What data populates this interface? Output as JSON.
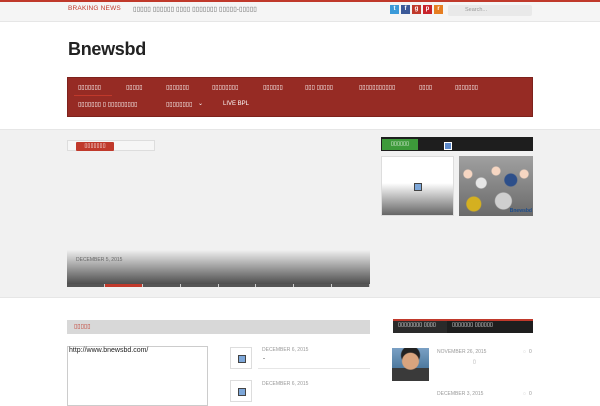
{
  "topbar": {
    "breaking_label": "BRAKING NEWS",
    "breaking_text": "▯▯▯▯▯ ▯▯▯▯▯▯ ▯▯▯▯ ▯▯▯▯▯▯▯ ▯▯▯▯▯-▯▯▯▯▯",
    "search_placeholder": "Search...",
    "social": [
      {
        "icon": "twitter-icon",
        "glyph": "t",
        "color": "#3b9ad9"
      },
      {
        "icon": "facebook-icon",
        "glyph": "f",
        "color": "#3b5998"
      },
      {
        "icon": "google-plus-icon",
        "glyph": "g",
        "color": "#c0392b"
      },
      {
        "icon": "pinterest-icon",
        "glyph": "p",
        "color": "#c8232c"
      },
      {
        "icon": "rss-icon",
        "glyph": "r",
        "color": "#e67e22"
      }
    ]
  },
  "site": {
    "logo": "Bnewsbd"
  },
  "nav": {
    "row1": [
      "▯▯▯▯▯▯▯",
      "▯▯▯▯▯",
      "▯▯▯▯▯▯▯",
      "▯▯▯▯▯▯▯▯",
      "▯▯▯▯▯▯",
      "▯▯▯ ▯▯▯▯▯",
      "▯▯▯▯▯▯▯▯▯▯▯",
      "▯▯▯▯",
      "▯▯▯▯▯▯▯"
    ],
    "row2": [
      "▯▯▯▯▯▯▯ ▯ ▯▯▯▯▯▯▯▯▯",
      "▯▯▯▯▯▯▯▯",
      "LIVE BPL"
    ]
  },
  "slider": {
    "tab_label": "▯▯▯▯▯▯▯",
    "date": "DECEMBER 5, 2015"
  },
  "sidebar_featured": {
    "label": "▯▯▯▯▯▯",
    "photo_tag": "Bnewsbd"
  },
  "news_section": {
    "label": "▯▯▯▯▯",
    "url_text": "http://www.bnewsbd.com/",
    "items": [
      {
        "date": "DECEMBER 6, 2015",
        "title": "-"
      },
      {
        "date": "DECEMBER 6, 2015",
        "title": ""
      }
    ]
  },
  "side_tabs": {
    "tabs": [
      "▯▯▯▯▯▯▯▯ ▯▯▯▯",
      "▯▯▯▯▯▯▯ ▯▯▯▯▯▯"
    ],
    "items": [
      {
        "date": "NOVEMBER 26, 2015",
        "comments": "0"
      },
      {
        "date": "DECEMBER 3, 2015",
        "comments": "0"
      }
    ]
  },
  "colors": {
    "accent": "#c0392b",
    "nav_bg": "#962b24",
    "green": "#3d9a3a"
  }
}
